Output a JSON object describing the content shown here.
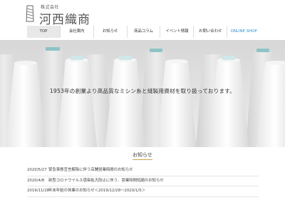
{
  "header": {
    "logo_icon": "thread-spool-icon",
    "logo_sub": "株式会社",
    "logo_name": "河西織商"
  },
  "nav": {
    "items": [
      {
        "label": "TOP"
      },
      {
        "label": "会社案内"
      },
      {
        "label": "お知らせ"
      },
      {
        "label": "商品コラム"
      },
      {
        "label": "イベント情報"
      },
      {
        "label": "お問い合わせ"
      },
      {
        "label": "ONLINE SHOP"
      }
    ],
    "active_index": 0,
    "shop_color": "#2a93d5"
  },
  "hero": {
    "image": "white-thread-cones-photo",
    "text": "1953年の創業より高品質なミシン糸と縫製用資材を取り扱っております。"
  },
  "news": {
    "title": "お知らせ",
    "accent_color": "#c9a64b",
    "items": [
      {
        "date": "2020/5/27",
        "text": "緊急事態宣言解除に伴う店舗営業時間のお知らせ"
      },
      {
        "date": "2020/4/8",
        "text": "新型コロナウイルス感染拡大防止に伴う、営業時間短縮のお知らせ"
      },
      {
        "date": "2019/11/28",
        "text": "年末年始の休業のお知らせ＜2019/12/28〜2020/1/5＞"
      }
    ]
  }
}
